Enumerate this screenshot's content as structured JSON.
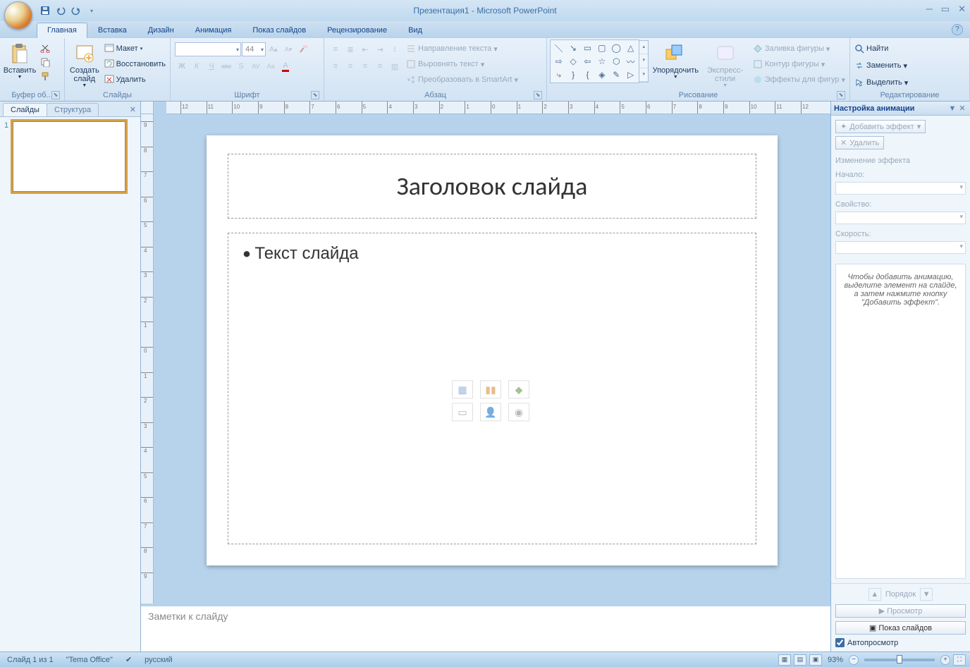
{
  "title": "Презентация1 - Microsoft PowerPoint",
  "tabs": [
    "Главная",
    "Вставка",
    "Дизайн",
    "Анимация",
    "Показ слайдов",
    "Рецензирование",
    "Вид"
  ],
  "activeTab": 0,
  "ribbon": {
    "clipboard": {
      "paste": "Вставить",
      "label": "Буфер об..."
    },
    "slides": {
      "new": "Создать\nслайд",
      "layout": "Макет",
      "reset": "Восстановить",
      "delete": "Удалить",
      "label": "Слайды"
    },
    "font": {
      "size": "44",
      "label": "Шрифт",
      "buttons": [
        "Ж",
        "К",
        "Ч",
        "abc",
        "S",
        "AV",
        "Aa",
        "A"
      ]
    },
    "paragraph": {
      "textdir": "Направление текста",
      "align": "Выровнять текст",
      "smartart": "Преобразовать в SmartArt",
      "label": "Абзац"
    },
    "drawing": {
      "arrange": "Упорядочить",
      "styles": "Экспресс-стили",
      "fill": "Заливка фигуры",
      "outline": "Контур фигуры",
      "effects": "Эффекты для фигур",
      "label": "Рисование"
    },
    "editing": {
      "find": "Найти",
      "replace": "Заменить",
      "select": "Выделить",
      "label": "Редактирование"
    }
  },
  "leftTabs": {
    "slides": "Слайды",
    "outline": "Структура"
  },
  "thumb": {
    "num": "1"
  },
  "slide": {
    "title": "Заголовок слайда",
    "body": "Текст слайда"
  },
  "notes": "Заметки к слайду",
  "rightPane": {
    "title": "Настройка анимации",
    "addEffect": "Добавить эффект",
    "remove": "Удалить",
    "changeSection": "Изменение эффекта",
    "start": "Начало:",
    "property": "Свойство:",
    "speed": "Скорость:",
    "hint": "Чтобы добавить анимацию, выделите элемент на слайде, а затем нажмите кнопку \"Добавить эффект\".",
    "order": "Порядок",
    "preview": "Просмотр",
    "slideshow": "Показ слайдов",
    "autopreview": "Автопросмотр"
  },
  "status": {
    "slideOf": "Слайд 1 из 1",
    "theme": "\"Tema Office\"",
    "lang": "русский",
    "zoom": "93%"
  }
}
